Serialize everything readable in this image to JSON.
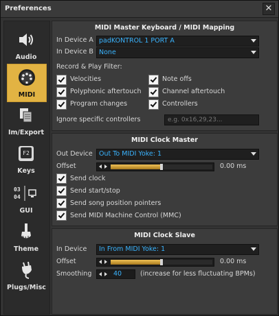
{
  "window": {
    "title": "Preferences",
    "close_glyph": "✕"
  },
  "sidebar": {
    "items": [
      {
        "label": "Audio",
        "icon": "speaker-icon"
      },
      {
        "label": "MIDI",
        "icon": "midi-connector-icon",
        "active": true
      },
      {
        "label": "Im/Export",
        "icon": "file-export-icon"
      },
      {
        "label": "Keys",
        "icon": "keyboard-key-icon",
        "key_text": "F2"
      },
      {
        "label": "GUI",
        "icon": "gui-display-icon",
        "digits_top": "03",
        "digits_bottom": "04"
      },
      {
        "label": "Theme",
        "icon": "paint-brush-icon"
      },
      {
        "label": "Plugs/Misc",
        "icon": "plug-icon"
      }
    ]
  },
  "master_keyboard": {
    "title": "MIDI Master Keyboard / MIDI Mapping",
    "device_a_label": "In Device A",
    "device_a_value": "padKONTROL 1 PORT A",
    "device_b_label": "In Device B",
    "device_b_value": "None",
    "filter_heading": "Record & Play Filter:",
    "filters": [
      {
        "label": "Velocities",
        "checked": true
      },
      {
        "label": "Note offs",
        "checked": true
      },
      {
        "label": "Polyphonic aftertouch",
        "checked": true
      },
      {
        "label": "Channel aftertouch",
        "checked": true
      },
      {
        "label": "Program changes",
        "checked": true
      },
      {
        "label": "Controllers",
        "checked": true
      }
    ],
    "ignore_label": "Ignore specific controllers",
    "ignore_placeholder": "e.g. 0x16,29,23..."
  },
  "clock_master": {
    "title": "MIDI Clock Master",
    "out_device_label": "Out Device",
    "out_device_value": "Out To MIDI Yoke:  1",
    "offset_label": "Offset",
    "offset_value": "0.00 ms",
    "offset_fraction": 0.5,
    "options": [
      {
        "label": "Send clock",
        "checked": true
      },
      {
        "label": "Send start/stop",
        "checked": true
      },
      {
        "label": "Send song position pointers",
        "checked": true
      },
      {
        "label": "Send MIDI Machine Control (MMC)",
        "checked": true
      }
    ]
  },
  "clock_slave": {
    "title": "MIDI Clock Slave",
    "in_device_label": "In Device",
    "in_device_value": "In From MIDI Yoke:  1",
    "offset_label": "Offset",
    "offset_value": "0.00 ms",
    "offset_fraction": 0.5,
    "smoothing_label": "Smoothing",
    "smoothing_value": "40",
    "smoothing_hint": "(increase for less fluctuating BPMs)"
  },
  "colors": {
    "accent": "#e2b343",
    "value_text": "#3ab4ff"
  }
}
